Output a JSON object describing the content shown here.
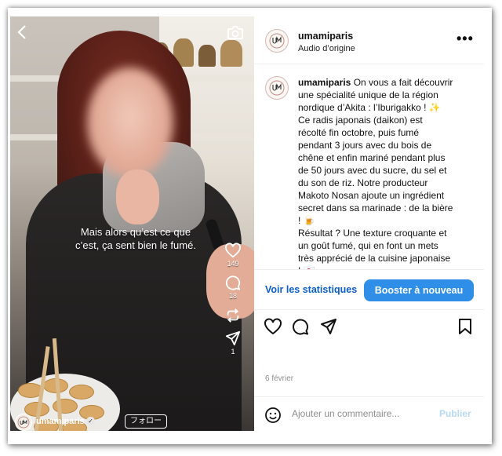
{
  "post": {
    "username": "umamiparis",
    "audio": "Audio d’origine",
    "more": "•••",
    "caption_lines": [
      "On vous a fait découvrir",
      "une spécialité unique de la région",
      "nordique d’Akita : l’Iburigakko ! ✨",
      "Ce radis japonais (daikon) est",
      "récolté fin octobre, puis fumé",
      "pendant 3 jours avec du bois de",
      "chêne et enfin mariné pendant plus",
      "de 50 jours avec du sucre, du sel et",
      "du son de riz. Notre producteur",
      "Makoto Nosan ajoute un ingrédient",
      "secret dans sa marinade : de la bière",
      "! 🍺",
      "Résultat ? Une texture croquante et",
      "un goût fumé, qui en font un mets",
      "très apprécié de la cuisine japonaise",
      "! 🇯🇵"
    ],
    "stats_link": "Voir les statistiques",
    "boost_button": "Booster à nouveau",
    "date": "6 février",
    "comment_placeholder": "Ajouter un commentaire...",
    "publish": "Publier"
  },
  "video": {
    "subtitle_line1": "Mais alors qu’est ce que",
    "subtitle_line2": "c’est, ça sent bien le fumé.",
    "likes": "149",
    "comments": "18",
    "shares": "1",
    "user": "umamiparis",
    "verified": "✓",
    "follow": "フォロー"
  },
  "icons": {
    "back": "back-chevron-icon",
    "camera": "camera-icon",
    "heart": "heart-icon",
    "comment": "comment-bubble-icon",
    "repost": "repost-icon",
    "send": "send-icon",
    "bookmark": "bookmark-icon",
    "emoji": "emoji-icon"
  },
  "colors": {
    "accent": "#2f8fe8",
    "link": "#0b5ec9",
    "muted": "#8e8e8e"
  }
}
